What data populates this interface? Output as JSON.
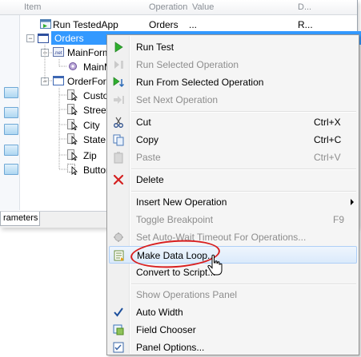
{
  "columns": {
    "item": "Item",
    "operation": "Operation",
    "value": "Value",
    "desc": "D..."
  },
  "tree": {
    "run_tested_app": {
      "item": "Run TestedApp",
      "operation": "Orders",
      "value": "...",
      "desc": "R..."
    },
    "orders": "Orders",
    "main_form": "MainForm",
    "main_menu": "MainM",
    "order_form": "OrderForm",
    "children": [
      "Custon",
      "Street",
      "City",
      "State",
      "Zip",
      "Button"
    ]
  },
  "bottom_tab": "rameters",
  "menu": {
    "run_test": "Run Test",
    "run_selected": "Run Selected Operation",
    "run_from_selected": "Run From Selected Operation",
    "set_next": "Set Next Operation",
    "cut": "Cut",
    "cut_sc": "Ctrl+X",
    "copy": "Copy",
    "copy_sc": "Ctrl+C",
    "paste": "Paste",
    "paste_sc": "Ctrl+V",
    "delete": "Delete",
    "insert_new": "Insert New Operation",
    "toggle_bp": "Toggle Breakpoint",
    "toggle_bp_sc": "F9",
    "set_autowait": "Set Auto-Wait Timeout For Operations...",
    "make_data_loop": "Make Data Loop...",
    "convert_script": "Convert to Script...",
    "show_ops_panel": "Show Operations Panel",
    "auto_width": "Auto Width",
    "field_chooser": "Field Chooser",
    "panel_options": "Panel Options..."
  },
  "colors": {
    "selection": "#3399ff",
    "highlight_ellipse": "#d81e1e",
    "run_green": "#2fae2f",
    "delete_red": "#d42020"
  }
}
